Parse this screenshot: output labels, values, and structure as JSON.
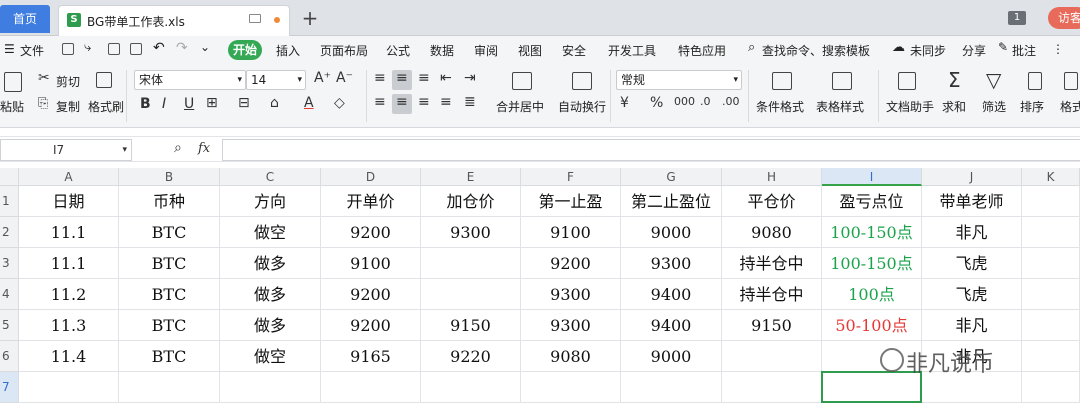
{
  "tabbar": {
    "home": "首页",
    "file_name": "BG带单工作表.xls",
    "file_type_icon": "S",
    "page_badge": "1",
    "visitor": "访客"
  },
  "menu": {
    "file": "文件",
    "items": [
      "开始",
      "插入",
      "页面布局",
      "公式",
      "数据",
      "审阅",
      "视图",
      "安全",
      "开发工具",
      "特色应用"
    ],
    "search": "查找命令、搜索模板",
    "sync": "未同步",
    "share": "分享",
    "comment": "批注"
  },
  "ribbon": {
    "paste": "粘贴",
    "cut": "剪切",
    "copy": "复制",
    "format_painter": "格式刷",
    "font_name": "宋体",
    "font_size": "14",
    "merge_center": "合并居中",
    "wrap_text": "自动换行",
    "number_format": "常规",
    "conditional_format": "条件格式",
    "table_style": "表格样式",
    "doc_helper": "文档助手",
    "sum": "求和",
    "filter": "筛选",
    "sort": "排序",
    "format": "格式"
  },
  "formula_bar": {
    "cell_ref": "I7",
    "fx": "fx",
    "value": ""
  },
  "sheet": {
    "columns": [
      "A",
      "B",
      "C",
      "D",
      "E",
      "F",
      "G",
      "H",
      "I",
      "J",
      "K"
    ],
    "rows": [
      "1",
      "2",
      "3",
      "4",
      "5",
      "6",
      "7"
    ],
    "header": [
      "日期",
      "币种",
      "方向",
      "开单价",
      "加仓价",
      "第一止盈",
      "第二止盈位",
      "平仓价",
      "盈亏点位",
      "带单老师"
    ],
    "data": [
      [
        "11.1",
        "BTC",
        "做空",
        "9200",
        "9300",
        "9100",
        "9000",
        "9080",
        "100-150点",
        "非凡"
      ],
      [
        "11.1",
        "BTC",
        "做多",
        "9100",
        "",
        "9200",
        "9300",
        "持半仓中",
        "100-150点",
        "飞虎"
      ],
      [
        "11.2",
        "BTC",
        "做多",
        "9200",
        "",
        "9300",
        "9400",
        "持半仓中",
        "100点",
        "飞虎"
      ],
      [
        "11.3",
        "BTC",
        "做多",
        "9200",
        "9150",
        "9300",
        "9400",
        "9150",
        "50-100点",
        "非凡"
      ],
      [
        "11.4",
        "BTC",
        "做空",
        "9165",
        "9220",
        "9080",
        "9000",
        "",
        "",
        "非凡"
      ]
    ],
    "pnl_colors": [
      "#1aa34a",
      "#1aa34a",
      "#1aa34a",
      "#e53935",
      "#1aa34a"
    ]
  },
  "watermark": "非凡说币"
}
